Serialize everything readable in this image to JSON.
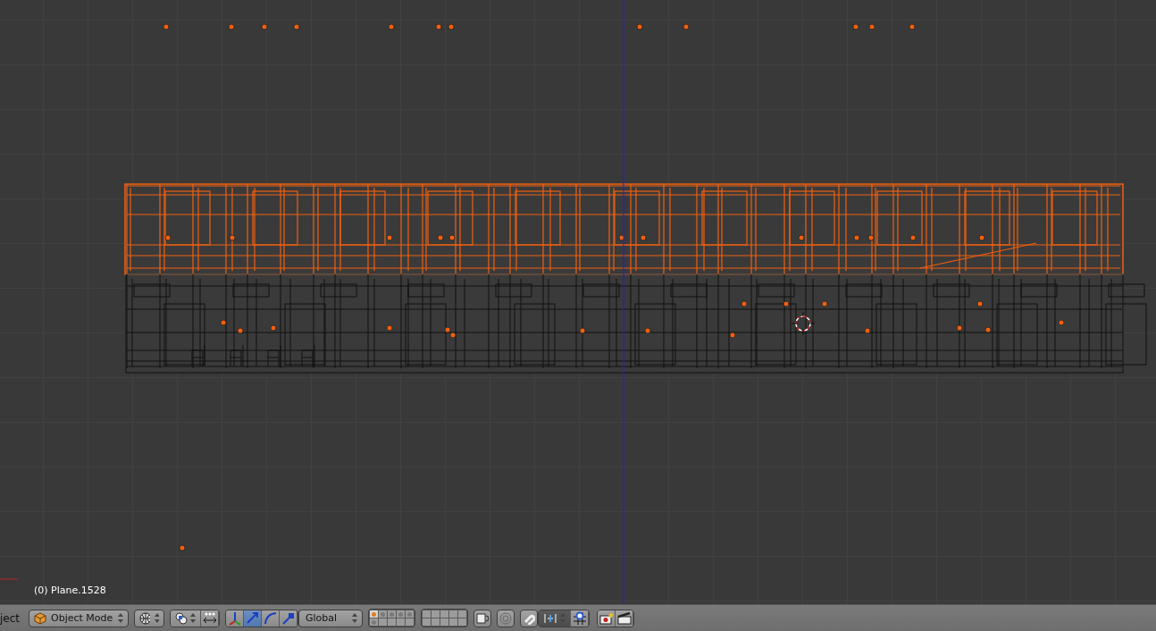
{
  "viewport": {
    "object_info": "(0) Plane.1528"
  },
  "header": {
    "menu_cut": "ject",
    "mode": {
      "label": "Object Mode"
    },
    "manipulators": [
      {
        "kind": "axes",
        "selected": false
      },
      {
        "kind": "translate",
        "selected": true
      },
      {
        "kind": "rotate",
        "selected": false
      },
      {
        "kind": "scale",
        "selected": false
      }
    ],
    "orientation": {
      "label": "Global"
    },
    "layer_blocks": [
      {
        "layers": [
          {
            "selected": true,
            "occupied": true
          },
          {
            "selected": false,
            "occupied": true
          },
          {
            "selected": false,
            "occupied": true
          },
          {
            "selected": false,
            "occupied": true
          },
          {
            "selected": false,
            "occupied": true
          },
          {
            "selected": false,
            "occupied": true
          },
          {
            "selected": false,
            "occupied": false
          },
          {
            "selected": false,
            "occupied": false
          },
          {
            "selected": false,
            "occupied": false
          },
          {
            "selected": false,
            "occupied": false
          }
        ]
      },
      {
        "layers": [
          {
            "selected": false,
            "occupied": false
          },
          {
            "selected": false,
            "occupied": false
          },
          {
            "selected": false,
            "occupied": false
          },
          {
            "selected": false,
            "occupied": false
          },
          {
            "selected": false,
            "occupied": false
          },
          {
            "selected": false,
            "occupied": false
          },
          {
            "selected": false,
            "occupied": false
          },
          {
            "selected": false,
            "occupied": false
          },
          {
            "selected": false,
            "occupied": false
          },
          {
            "selected": false,
            "occupied": false
          }
        ]
      }
    ],
    "snap": {
      "on": false
    }
  }
}
